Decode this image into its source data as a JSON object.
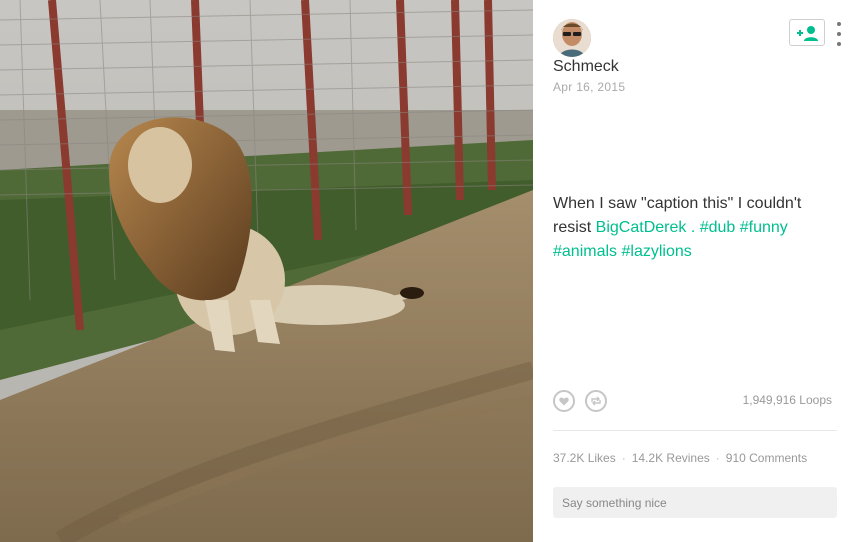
{
  "post": {
    "username": "Schmeck",
    "date": "Apr 16, 2015",
    "caption_text": "When I saw \"caption this\" I couldn't resist ",
    "mention": "BigCatDerek",
    "caption_sep": " . ",
    "hashtags": [
      "#dub",
      "#funny",
      "#animals",
      "#lazylions"
    ]
  },
  "stats": {
    "loops": "1,949,916 Loops",
    "likes": "37.2K Likes",
    "revines": "14.2K Revines",
    "comments": "910 Comments",
    "separator": "·"
  },
  "comment": {
    "placeholder": "Say something nice"
  },
  "colors": {
    "accent": "#00bf8f",
    "muted": "#999999"
  },
  "icons": {
    "follow": "add-person-icon",
    "more": "more-vertical-icon",
    "like": "heart-icon",
    "revine": "revine-icon"
  }
}
